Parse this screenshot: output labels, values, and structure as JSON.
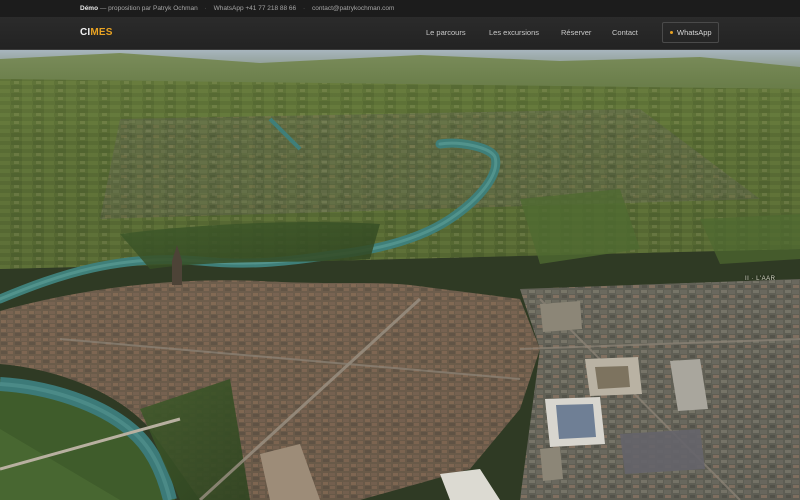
{
  "topbar": {
    "demo_label": "Démo",
    "credit": "— proposition par Patryk Ochman",
    "separator": "·",
    "whatsapp_text": "WhatsApp +41 77 218 88 66",
    "email": "contact@patrykochman.com"
  },
  "header": {
    "logo_part1": "CI",
    "logo_part2": "MES",
    "nav": [
      "Le parcours",
      "Les excursions",
      "Réserver",
      "Contact"
    ],
    "whatsapp_button": "WhatsApp"
  },
  "map": {
    "marker_label": "II · L'AAR"
  },
  "colors": {
    "accent": "#e9a323",
    "topbar_bg": "#1c1c1c",
    "navbar_bg": "#262626",
    "river": "#3f7f79"
  }
}
